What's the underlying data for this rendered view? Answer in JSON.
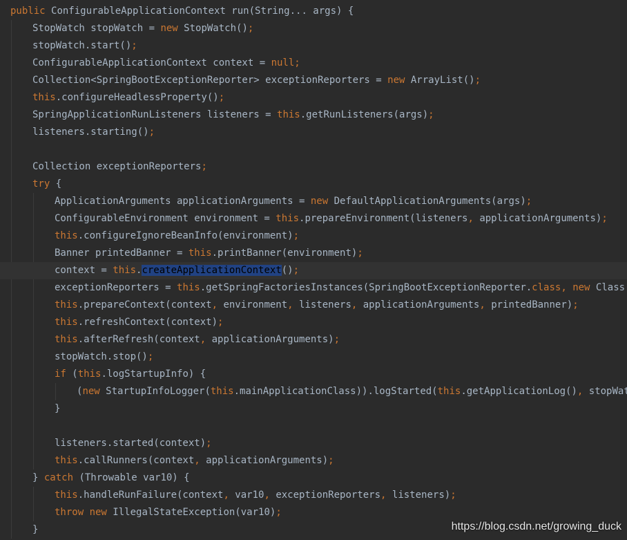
{
  "code": {
    "lines": [
      {
        "indent": 0,
        "segs": [
          [
            "kw",
            "public "
          ],
          [
            "pl",
            "ConfigurableApplicationContext run(String... args) {"
          ]
        ]
      },
      {
        "indent": 1,
        "segs": [
          [
            "pl",
            "StopWatch stopWatch = "
          ],
          [
            "kw",
            "new "
          ],
          [
            "pl",
            "StopWatch()"
          ],
          [
            "pu",
            ";"
          ]
        ]
      },
      {
        "indent": 1,
        "segs": [
          [
            "pl",
            "stopWatch.start()"
          ],
          [
            "pu",
            ";"
          ]
        ]
      },
      {
        "indent": 1,
        "segs": [
          [
            "pl",
            "ConfigurableApplicationContext context = "
          ],
          [
            "kw",
            "null"
          ],
          [
            "pu",
            ";"
          ]
        ]
      },
      {
        "indent": 1,
        "segs": [
          [
            "pl",
            "Collection<SpringBootExceptionReporter> exceptionReporters = "
          ],
          [
            "kw",
            "new "
          ],
          [
            "pl",
            "ArrayList()"
          ],
          [
            "pu",
            ";"
          ]
        ]
      },
      {
        "indent": 1,
        "segs": [
          [
            "kw",
            "this"
          ],
          [
            "pl",
            ".configureHeadlessProperty()"
          ],
          [
            "pu",
            ";"
          ]
        ]
      },
      {
        "indent": 1,
        "segs": [
          [
            "pl",
            "SpringApplicationRunListeners listeners = "
          ],
          [
            "kw",
            "this"
          ],
          [
            "pl",
            ".getRunListeners(args)"
          ],
          [
            "pu",
            ";"
          ]
        ]
      },
      {
        "indent": 1,
        "segs": [
          [
            "pl",
            "listeners.starting()"
          ],
          [
            "pu",
            ";"
          ]
        ]
      },
      {
        "indent": 1,
        "segs": []
      },
      {
        "indent": 1,
        "segs": [
          [
            "pl",
            "Collection exceptionReporters"
          ],
          [
            "pu",
            ";"
          ]
        ]
      },
      {
        "indent": 1,
        "segs": [
          [
            "kw",
            "try "
          ],
          [
            "pl",
            "{"
          ]
        ]
      },
      {
        "indent": 2,
        "segs": [
          [
            "pl",
            "ApplicationArguments applicationArguments = "
          ],
          [
            "kw",
            "new "
          ],
          [
            "pl",
            "DefaultApplicationArguments(args)"
          ],
          [
            "pu",
            ";"
          ]
        ]
      },
      {
        "indent": 2,
        "segs": [
          [
            "pl",
            "ConfigurableEnvironment environment = "
          ],
          [
            "kw",
            "this"
          ],
          [
            "pl",
            ".prepareEnvironment(listeners"
          ],
          [
            "pu",
            ", "
          ],
          [
            "pl",
            "applicationArguments)"
          ],
          [
            "pu",
            ";"
          ]
        ]
      },
      {
        "indent": 2,
        "segs": [
          [
            "kw",
            "this"
          ],
          [
            "pl",
            ".configureIgnoreBeanInfo(environment)"
          ],
          [
            "pu",
            ";"
          ]
        ]
      },
      {
        "indent": 2,
        "segs": [
          [
            "pl",
            "Banner printedBanner = "
          ],
          [
            "kw",
            "this"
          ],
          [
            "pl",
            ".printBanner(environment)"
          ],
          [
            "pu",
            ";"
          ]
        ]
      },
      {
        "indent": 2,
        "current": true,
        "segs": [
          [
            "pl",
            "context = "
          ],
          [
            "kw",
            "this"
          ],
          [
            "pl",
            "."
          ],
          [
            "sel",
            "createApplicationContext"
          ],
          [
            "pl",
            "()"
          ],
          [
            "pu",
            ";"
          ]
        ]
      },
      {
        "indent": 2,
        "segs": [
          [
            "pl",
            "exceptionReporters = "
          ],
          [
            "kw",
            "this"
          ],
          [
            "pl",
            ".getSpringFactoriesInstances(SpringBootExceptionReporter."
          ],
          [
            "kw",
            "class"
          ],
          [
            "pu",
            ", "
          ],
          [
            "kw",
            "new "
          ],
          [
            "pl",
            "Class[]{ConfigurableApplicationContext.class}, context);"
          ]
        ]
      },
      {
        "indent": 2,
        "segs": [
          [
            "kw",
            "this"
          ],
          [
            "pl",
            ".prepareContext(context"
          ],
          [
            "pu",
            ", "
          ],
          [
            "pl",
            "environment"
          ],
          [
            "pu",
            ", "
          ],
          [
            "pl",
            "listeners"
          ],
          [
            "pu",
            ", "
          ],
          [
            "pl",
            "applicationArguments"
          ],
          [
            "pu",
            ", "
          ],
          [
            "pl",
            "printedBanner)"
          ],
          [
            "pu",
            ";"
          ]
        ]
      },
      {
        "indent": 2,
        "segs": [
          [
            "kw",
            "this"
          ],
          [
            "pl",
            ".refreshContext(context)"
          ],
          [
            "pu",
            ";"
          ]
        ]
      },
      {
        "indent": 2,
        "segs": [
          [
            "kw",
            "this"
          ],
          [
            "pl",
            ".afterRefresh(context"
          ],
          [
            "pu",
            ", "
          ],
          [
            "pl",
            "applicationArguments)"
          ],
          [
            "pu",
            ";"
          ]
        ]
      },
      {
        "indent": 2,
        "segs": [
          [
            "pl",
            "stopWatch.stop()"
          ],
          [
            "pu",
            ";"
          ]
        ]
      },
      {
        "indent": 2,
        "segs": [
          [
            "kw",
            "if "
          ],
          [
            "pl",
            "("
          ],
          [
            "kw",
            "this"
          ],
          [
            "pl",
            ".logStartupInfo) {"
          ]
        ]
      },
      {
        "indent": 3,
        "segs": [
          [
            "pl",
            "("
          ],
          [
            "kw",
            "new "
          ],
          [
            "pl",
            "StartupInfoLogger("
          ],
          [
            "kw",
            "this"
          ],
          [
            "pl",
            ".mainApplicationClass)).logStarted("
          ],
          [
            "kw",
            "this"
          ],
          [
            "pl",
            ".getApplicationLog()"
          ],
          [
            "pu",
            ", "
          ],
          [
            "pl",
            "stopWatch);"
          ]
        ]
      },
      {
        "indent": 2,
        "segs": [
          [
            "pl",
            "}"
          ]
        ]
      },
      {
        "indent": 2,
        "segs": []
      },
      {
        "indent": 2,
        "segs": [
          [
            "pl",
            "listeners.started(context)"
          ],
          [
            "pu",
            ";"
          ]
        ]
      },
      {
        "indent": 2,
        "segs": [
          [
            "kw",
            "this"
          ],
          [
            "pl",
            ".callRunners(context"
          ],
          [
            "pu",
            ", "
          ],
          [
            "pl",
            "applicationArguments)"
          ],
          [
            "pu",
            ";"
          ]
        ]
      },
      {
        "indent": 1,
        "segs": [
          [
            "pl",
            "} "
          ],
          [
            "kw",
            "catch "
          ],
          [
            "pl",
            "(Throwable var10) {"
          ]
        ]
      },
      {
        "indent": 2,
        "segs": [
          [
            "kw",
            "this"
          ],
          [
            "pl",
            ".handleRunFailure(context"
          ],
          [
            "pu",
            ", "
          ],
          [
            "pl",
            "var10"
          ],
          [
            "pu",
            ", "
          ],
          [
            "pl",
            "exceptionReporters"
          ],
          [
            "pu",
            ", "
          ],
          [
            "pl",
            "listeners)"
          ],
          [
            "pu",
            ";"
          ]
        ]
      },
      {
        "indent": 2,
        "segs": [
          [
            "kw",
            "throw new "
          ],
          [
            "pl",
            "IllegalStateException(var10)"
          ],
          [
            "pu",
            ";"
          ]
        ]
      },
      {
        "indent": 1,
        "segs": [
          [
            "pl",
            "}"
          ]
        ]
      }
    ]
  },
  "watermark": "https://blog.csdn.net/growing_duck",
  "colors": {
    "background": "#2b2b2b",
    "keyword": "#cc7832",
    "plain": "#a9b7c6",
    "selection": "#214283",
    "current_line": "#323232"
  }
}
